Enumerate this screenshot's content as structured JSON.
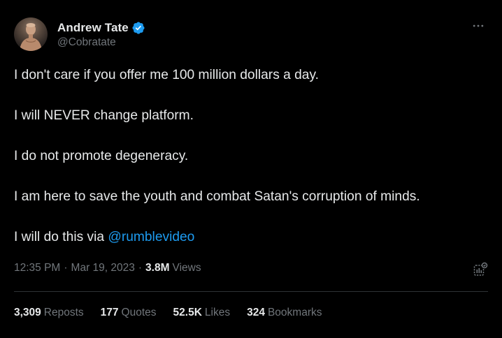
{
  "author": {
    "display_name": "Andrew Tate",
    "handle": "@Cobratate",
    "verified": true,
    "avatar_icon": "avatar-photo"
  },
  "post": {
    "paragraphs": [
      "I don't care if you offer me 100 million dollars a day.",
      "I will NEVER change platform.",
      "I do not promote degeneracy.",
      "I am here to save the youth and combat Satan's corruption of minds."
    ],
    "last_line_prefix": "I will do this via ",
    "mention": "@rumblevideo"
  },
  "meta": {
    "time": "12:35 PM",
    "date": "Mar 19, 2023",
    "separator": "·",
    "views_count": "3.8M",
    "views_label": "Views"
  },
  "stats": [
    {
      "count": "3,309",
      "label": "Reposts"
    },
    {
      "count": "177",
      "label": "Quotes"
    },
    {
      "count": "52.5K",
      "label": "Likes"
    },
    {
      "count": "324",
      "label": "Bookmarks"
    }
  ],
  "colors": {
    "background": "#000000",
    "text_primary": "#e7e9ea",
    "text_secondary": "#71767b",
    "accent": "#1d9bf0",
    "divider": "#2f3336"
  },
  "icons": {
    "verified": "verified-badge-icon",
    "more": "more-options-icon",
    "analytics": "analytics-icon"
  }
}
